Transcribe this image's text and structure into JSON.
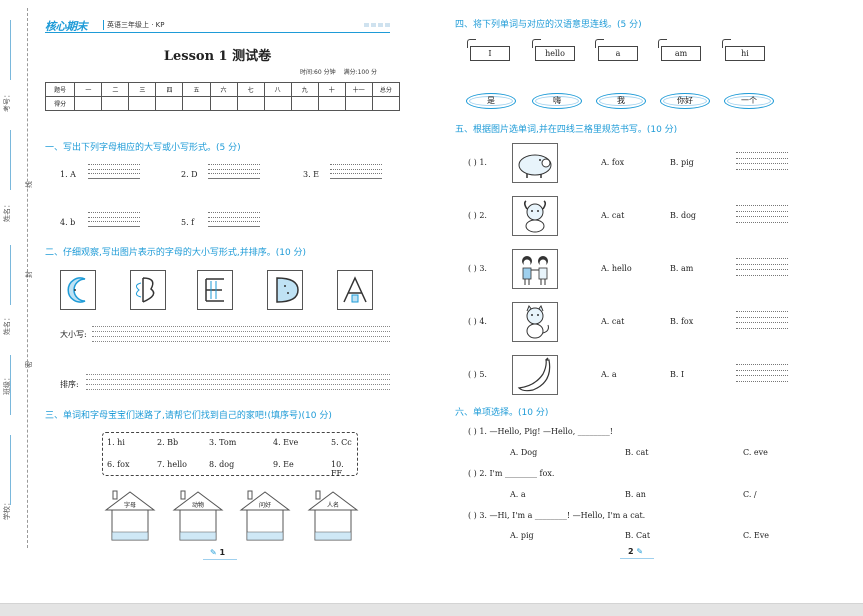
{
  "header": {
    "logo": "核心期末",
    "grade": "英语三年级上 · KP"
  },
  "binding": {
    "school": "学校：",
    "class": "班级：",
    "name": "姓名：",
    "number": "考号：",
    "cut_mi": "密",
    "cut_feng": "封",
    "cut_xian": "线"
  },
  "title": "Lesson 1 测试卷",
  "meta": {
    "time": "时间:60 分钟",
    "score": "满分:100 分"
  },
  "score_table": {
    "row1": [
      "题号",
      "一",
      "二",
      "三",
      "四",
      "五",
      "六",
      "七",
      "八",
      "九",
      "十",
      "十一",
      "总分"
    ],
    "row2_label": "得分"
  },
  "section1": {
    "title": "一、写出下列字母相应的大写或小写形式。(5 分)",
    "items": [
      "1. A",
      "2. D",
      "3. E",
      "4. b",
      "5. f"
    ]
  },
  "section2": {
    "title": "二、仔细观察,写出图片表示的字母的大小写形式,并排序。(10 分)",
    "case_label": "大小写:",
    "order_label": "排序:",
    "pictures": [
      "moon-letter-c",
      "butterfly-letter-b",
      "letter-e-comb",
      "watermelon-letter-d",
      "letter-a-house"
    ]
  },
  "section3": {
    "title": "三、单词和字母宝宝们迷路了,请帮它们找到自己的家吧!(填序号)(10 分)",
    "row1": [
      "1. hi",
      "2. Bb",
      "3. Tom",
      "4. Eve",
      "5. Cc"
    ],
    "row2": [
      "6. fox",
      "7. hello",
      "8. dog",
      "9. Ee",
      "10. FF"
    ],
    "houses": [
      "字母",
      "动物",
      "问好",
      "人名"
    ]
  },
  "page1": "1",
  "section4": {
    "title": "四、将下列单词与对应的汉语意思连线。(5 分)",
    "words": [
      "I",
      "hello",
      "a",
      "am",
      "hi"
    ],
    "meanings": [
      "是",
      "嗨",
      "我",
      "你好",
      "一个"
    ]
  },
  "section5": {
    "title": "五、根据图片选单词,并在四线三格里规范书写。(10 分)",
    "items": [
      {
        "num": "(      ) 1.",
        "a": "A. fox",
        "b": "B. pig",
        "pic": "pig-icon"
      },
      {
        "num": "(      ) 2.",
        "a": "A. cat",
        "b": "B. dog",
        "pic": "dog-icon"
      },
      {
        "num": "(      ) 3.",
        "a": "A. hello",
        "b": "B. am",
        "pic": "children-icon"
      },
      {
        "num": "(      ) 4.",
        "a": "A. cat",
        "b": "B. fox",
        "pic": "cat-icon"
      },
      {
        "num": "(      ) 5.",
        "a": "A. a",
        "b": "B. I",
        "pic": "banana-icon"
      }
    ]
  },
  "section6": {
    "title": "六、单项选择。(10 分)",
    "items": [
      {
        "q": "(      ) 1. —Hello, Pig! —Hello, ________!",
        "a": "A. Dog",
        "b": "B. cat",
        "c": "C. eve"
      },
      {
        "q": "(      ) 2. I'm ________ fox.",
        "a": "A. a",
        "b": "B. an",
        "c": "C. /"
      },
      {
        "q": "(      ) 3. —Hi, I'm a ________! —Hello, I'm a cat.",
        "a": "A. pig",
        "b": "B. Cat",
        "c": "C. Eve"
      }
    ]
  },
  "page2": "2",
  "colors": {
    "accent": "#1e9bd7",
    "light": "#9fd0ee"
  }
}
